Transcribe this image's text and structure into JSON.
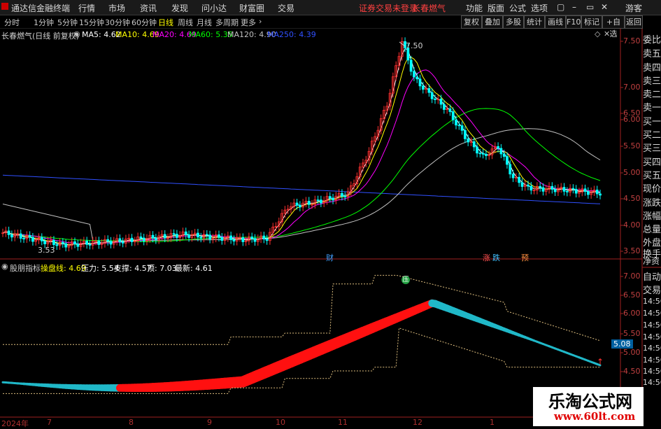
{
  "titlebar": {
    "app_name": "通达信金融终端",
    "menu": [
      "行情",
      "市场",
      "资讯",
      "发现",
      "问小达",
      "财富圈",
      "交易"
    ],
    "notice": "证券交易未登录",
    "stock_name": "长春燃气",
    "right_menu": [
      "功能",
      "版面",
      "公式",
      "选项"
    ],
    "guest": "游客",
    "colors": {
      "notice": "#ff4040"
    }
  },
  "period_tabs": [
    "分时",
    "1分钟",
    "5分钟",
    "15分钟",
    "30分钟",
    "60分钟",
    "日线",
    "周线",
    "月线",
    "多周期",
    "更多"
  ],
  "active_period": "日线",
  "toolbar": [
    "复权",
    "叠加",
    "多股",
    "统计",
    "画线",
    "F10",
    "标记",
    "+自选",
    "返回"
  ],
  "main_legend": {
    "title": "长春燃气(日线 前复权)",
    "items": [
      {
        "label": "MA5: 4.62",
        "color": "#ffffff"
      },
      {
        "label": "MA10: 4.69",
        "color": "#ffff00"
      },
      {
        "label": "MA20: 4.69",
        "color": "#ff00ff"
      },
      {
        "label": "MA60: 5.35",
        "color": "#00ff00"
      },
      {
        "label": "MA120: 4.90",
        "color": "#c0c0c0"
      },
      {
        "label": "MA250: 4.39",
        "color": "#3050ff"
      }
    ]
  },
  "price_axis": [
    "7.50",
    "7.00",
    "6.50",
    "6.00",
    "5.50",
    "5.00",
    "4.50",
    "4.00",
    "3.50"
  ],
  "annotations": {
    "high": "7.50",
    "low": "3.53",
    "tags": [
      "财",
      "涨",
      "跌",
      "预"
    ]
  },
  "sub_legend": {
    "title": "股朋指标",
    "items": [
      {
        "label": "操盘线: 4.69",
        "color": "#ffff00"
      },
      {
        "label": "压力: 5.54",
        "color": "#ffffff"
      },
      {
        "label": "支撑: 4.57",
        "color": "#ffffff"
      },
      {
        "label": "顶: 7.03",
        "color": "#ffffff"
      },
      {
        "label": "最新: 4.61",
        "color": "#ffffff"
      }
    ]
  },
  "sub_axis": [
    "7.00",
    "6.50",
    "6.00",
    "5.50",
    "5.00",
    "4.50"
  ],
  "sub_marker": {
    "value": "5.08",
    "signal": "压"
  },
  "right_panel_top": [
    "委比",
    "卖五",
    "卖四",
    "卖三",
    "卖二",
    "卖一",
    "买一",
    "买二",
    "买三",
    "买四",
    "买五",
    "现价",
    "涨跌",
    "涨幅",
    "总量",
    "外盘",
    "换手",
    "净资",
    "收益"
  ],
  "right_panel_bottom": [
    "自动",
    "交易",
    "14:56",
    "14:56",
    "14:56",
    "14:56",
    "14:56",
    "14:56",
    "14:56",
    "14:56"
  ],
  "date_axis": [
    "2024年",
    "7",
    "8",
    "9",
    "10",
    "11",
    "12",
    "1"
  ],
  "watermark": {
    "brand": "乐淘公式网",
    "url": "www.60lt.com"
  },
  "colors": {
    "up": "#ff3030",
    "down": "#00ffff",
    "axis": "#c04040",
    "sub_up": "#ff1010",
    "sub_down": "#20b8c8"
  }
}
